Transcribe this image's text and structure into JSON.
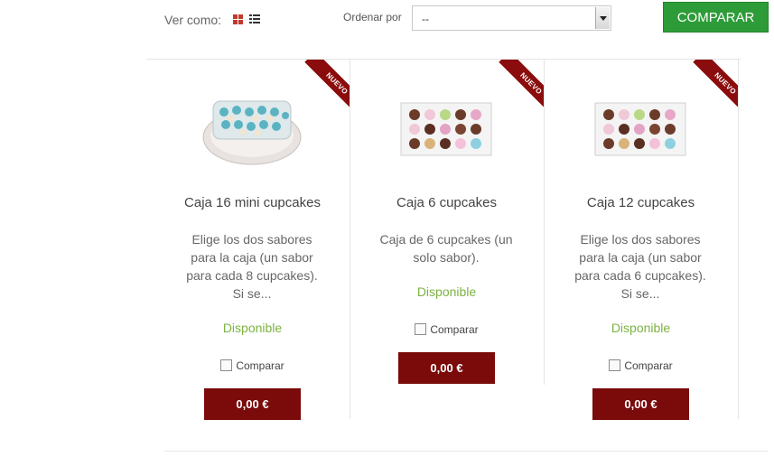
{
  "toolbar": {
    "view_label": "Ver como:",
    "view_grid_icon": "grid-view-icon",
    "view_list_icon": "list-view-icon",
    "sort_label": "Ordenar por",
    "sort_value": "--",
    "compare_button": "COMPARAR"
  },
  "colors": {
    "accent_red": "#7b0a0a",
    "ribbon": "#8b0c0c",
    "compare_green": "#2d9c38",
    "available_green": "#7cb342"
  },
  "products": [
    {
      "badge": "NUEVO",
      "title": "Caja 16 mini cupcakes",
      "description": [
        "Elige los dos sabores",
        "para la caja (un sabor",
        "para cada 8 cupcakes).",
        "Si se..."
      ],
      "availability": "Disponible",
      "compare_label": "Comparar",
      "price": "0,00 €"
    },
    {
      "badge": "NUEVO",
      "title": "Caja 6 cupcakes",
      "description": [
        "Caja de 6 cupcakes (un",
        "solo sabor)."
      ],
      "availability": "Disponible",
      "compare_label": "Comparar",
      "price": "0,00 €"
    },
    {
      "badge": "NUEVO",
      "title": "Caja 12 cupcakes",
      "description": [
        "Elige los dos sabores",
        "para la caja (un sabor",
        "para cada 6 cupcakes).",
        "Si se..."
      ],
      "availability": "Disponible",
      "compare_label": "Comparar",
      "price": "0,00 €"
    }
  ]
}
